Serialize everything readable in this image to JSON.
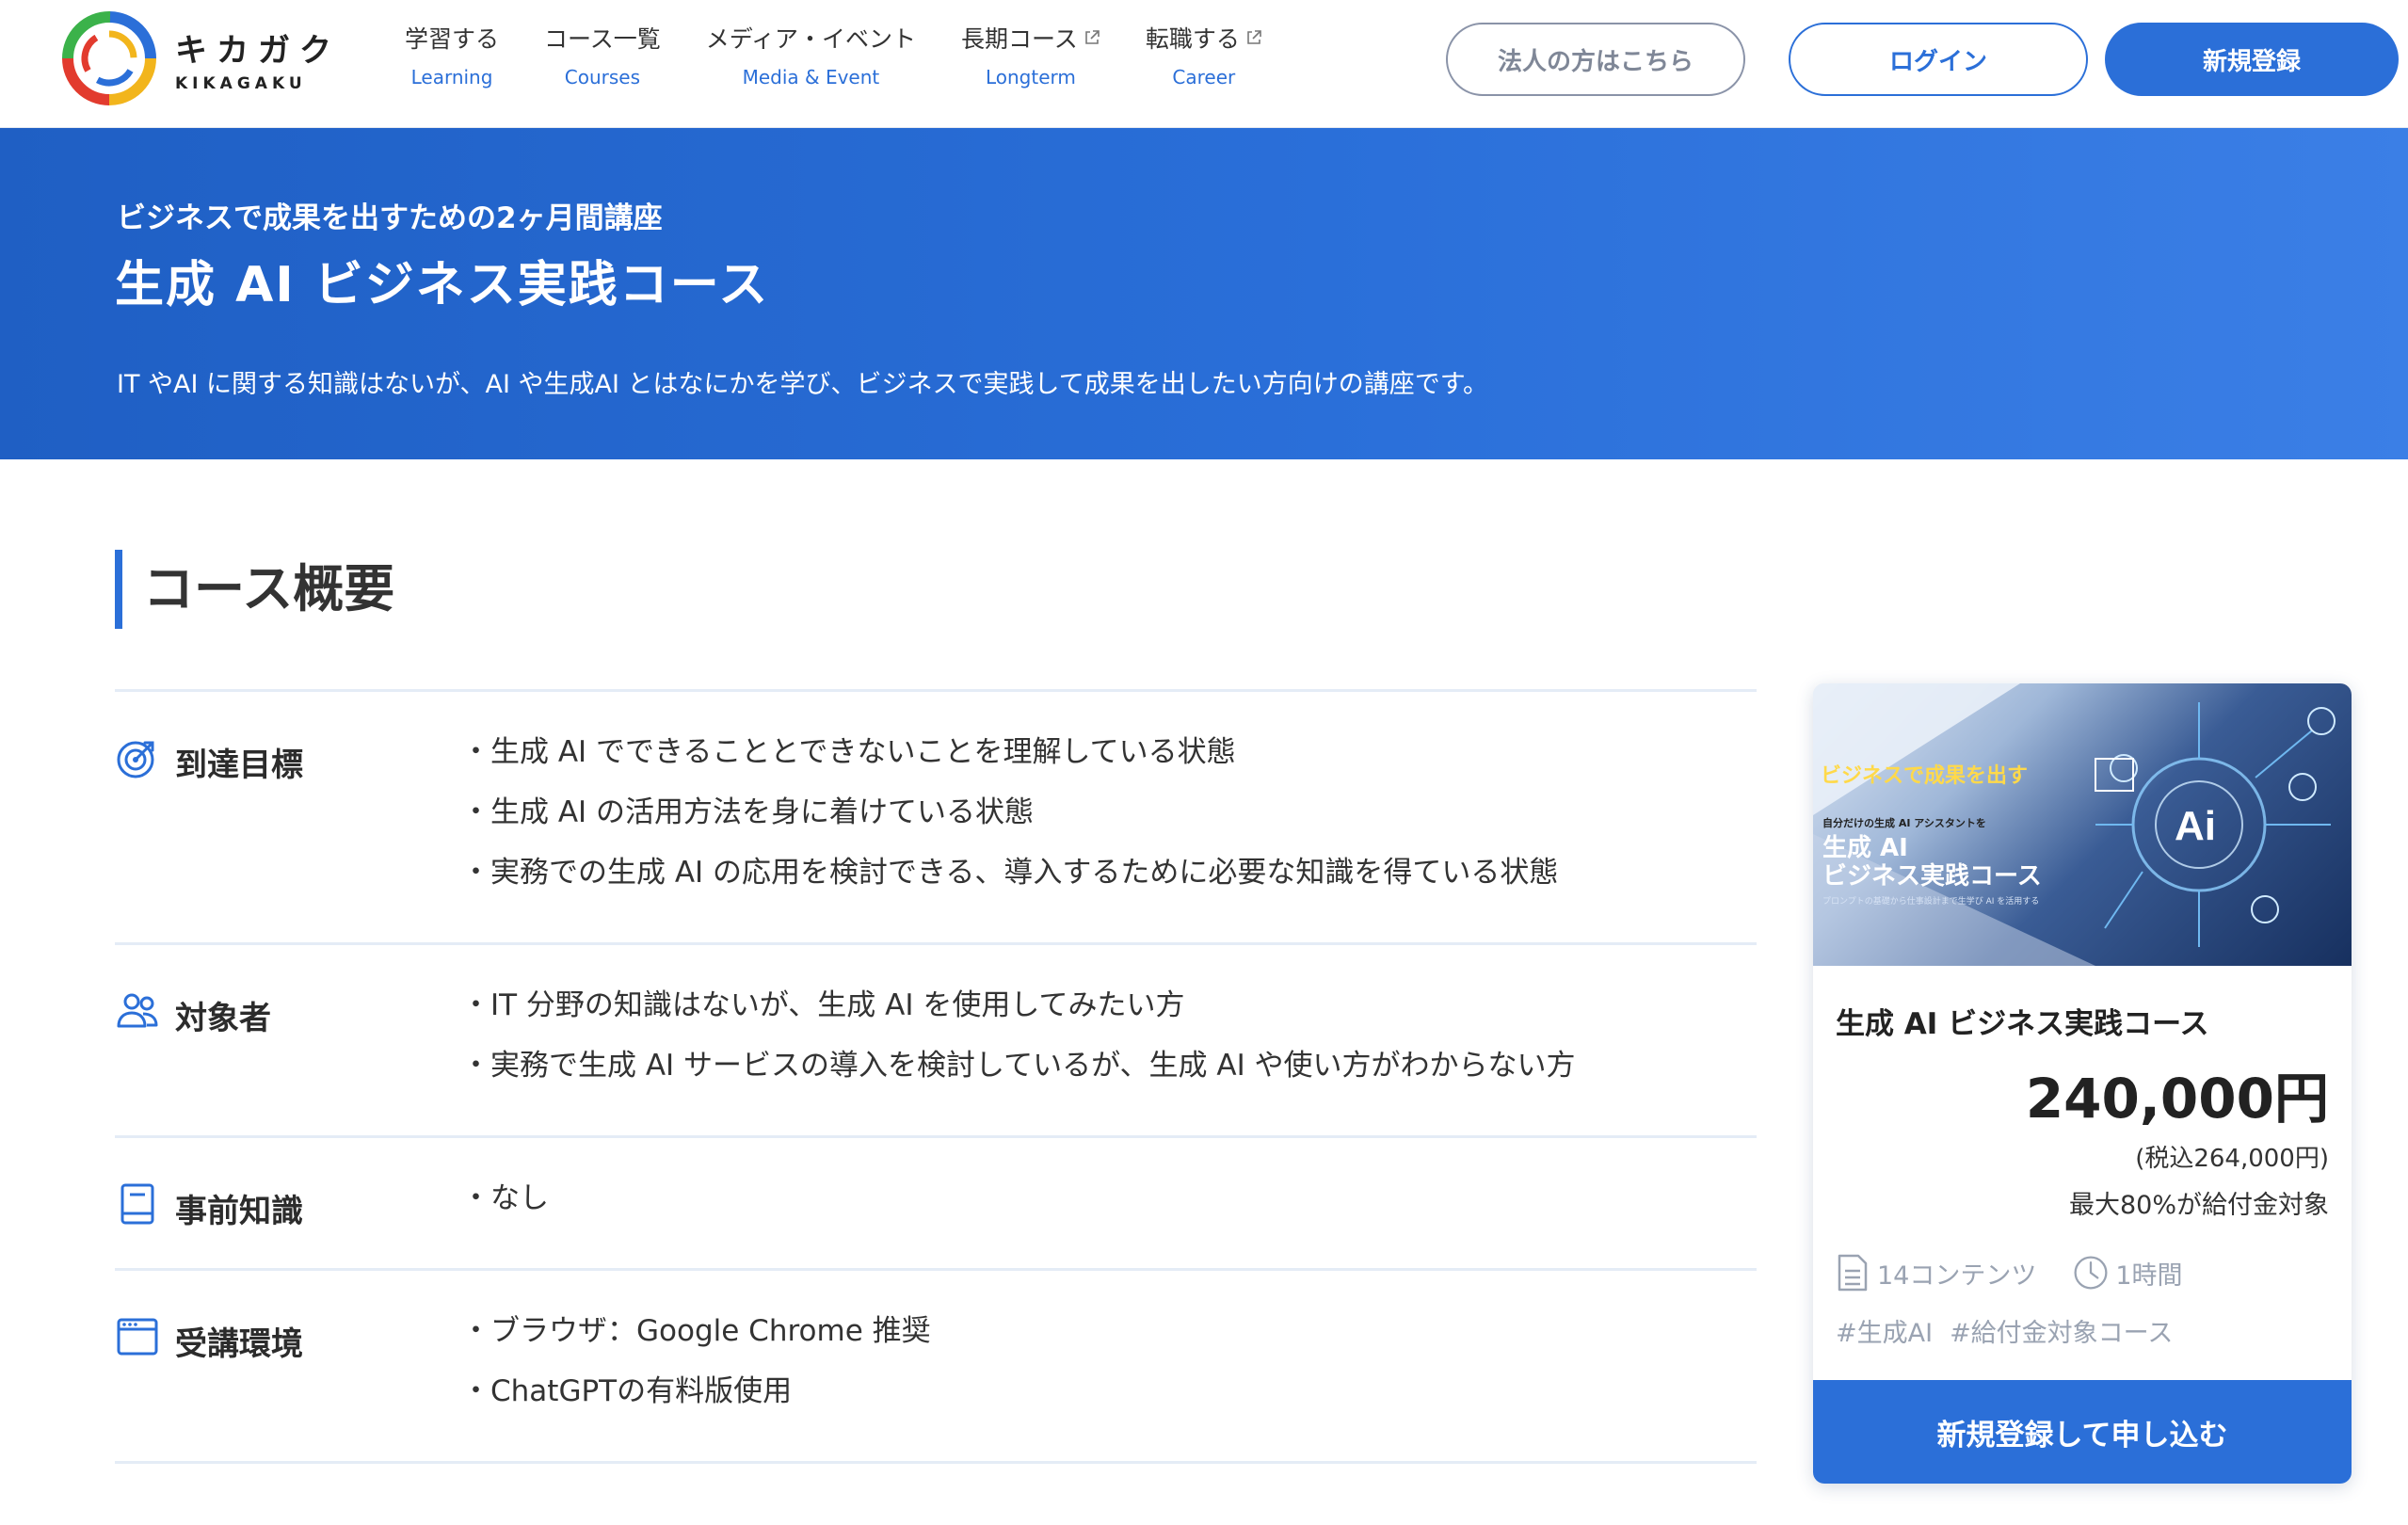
{
  "brand": {
    "name_jp": "キカガク",
    "name_en": "KIKAGAKU"
  },
  "nav": [
    {
      "jp": "学習する",
      "en": "Learning",
      "external": false
    },
    {
      "jp": "コース一覧",
      "en": "Courses",
      "external": false
    },
    {
      "jp": "メディア・イベント",
      "en": "Media & Event",
      "external": false
    },
    {
      "jp": "長期コース",
      "en": "Longterm",
      "external": true
    },
    {
      "jp": "転職する",
      "en": "Career",
      "external": true
    }
  ],
  "header_buttons": {
    "corporate": "法人の方はこちら",
    "login": "ログイン",
    "signup": "新規登録"
  },
  "hero": {
    "subtitle": "ビジネスで成果を出すための2ヶ月間講座",
    "title": "生成 AI ビジネス実践コース",
    "description": "IT やAI に関する知識はないが、AI や生成AI とはなにかを学び、ビジネスで実践して成果を出したい方向けの講座です。"
  },
  "section_title": "コース概要",
  "overview": [
    {
      "label": "到達目標",
      "icon": "target-icon",
      "items": [
        "・生成 AI でできることとできないことを理解している状態",
        "・生成 AI の活用方法を身に着けている状態",
        "・実務での生成 AI の応用を検討できる、導入するために必要な知識を得ている状態"
      ]
    },
    {
      "label": "対象者",
      "icon": "users-icon",
      "items": [
        "・IT 分野の知識はないが、生成 AI を使用してみたい方",
        "・実務で生成 AI サービスの導入を検討しているが、生成 AI や使い方がわからない方"
      ]
    },
    {
      "label": "事前知識",
      "icon": "book-icon",
      "items": [
        "・なし"
      ]
    },
    {
      "label": "受講環境",
      "icon": "browser-icon",
      "items": [
        "・ブラウザ：Google Chrome 推奨",
        "・ChatGPTの有料版使用"
      ]
    }
  ],
  "card": {
    "image_text": {
      "line1": "ビジネスで成果を出す",
      "line2": "自分だけの生成 AI アシスタントを",
      "title_a": "生成 AI",
      "title_b": "ビジネス実践コース",
      "footer": "プロンプトの基礎から仕事設計まで生学び AI を活用する"
    },
    "title": "生成 AI ビジネス実践コース",
    "price": "240,000円",
    "tax_included": "(税込264,000円)",
    "subsidy": "最大80%が給付金対象",
    "contents": "14コンテンツ",
    "duration": "1時間",
    "tags": [
      "#生成AI",
      "#給付金対象コース"
    ],
    "cta": "新規登録して申し込む"
  },
  "colors": {
    "accent": "#2b6fd8",
    "hero_start": "#1f5fc4",
    "hero_end": "#3b7fe6",
    "muted": "#9aa3b2"
  }
}
